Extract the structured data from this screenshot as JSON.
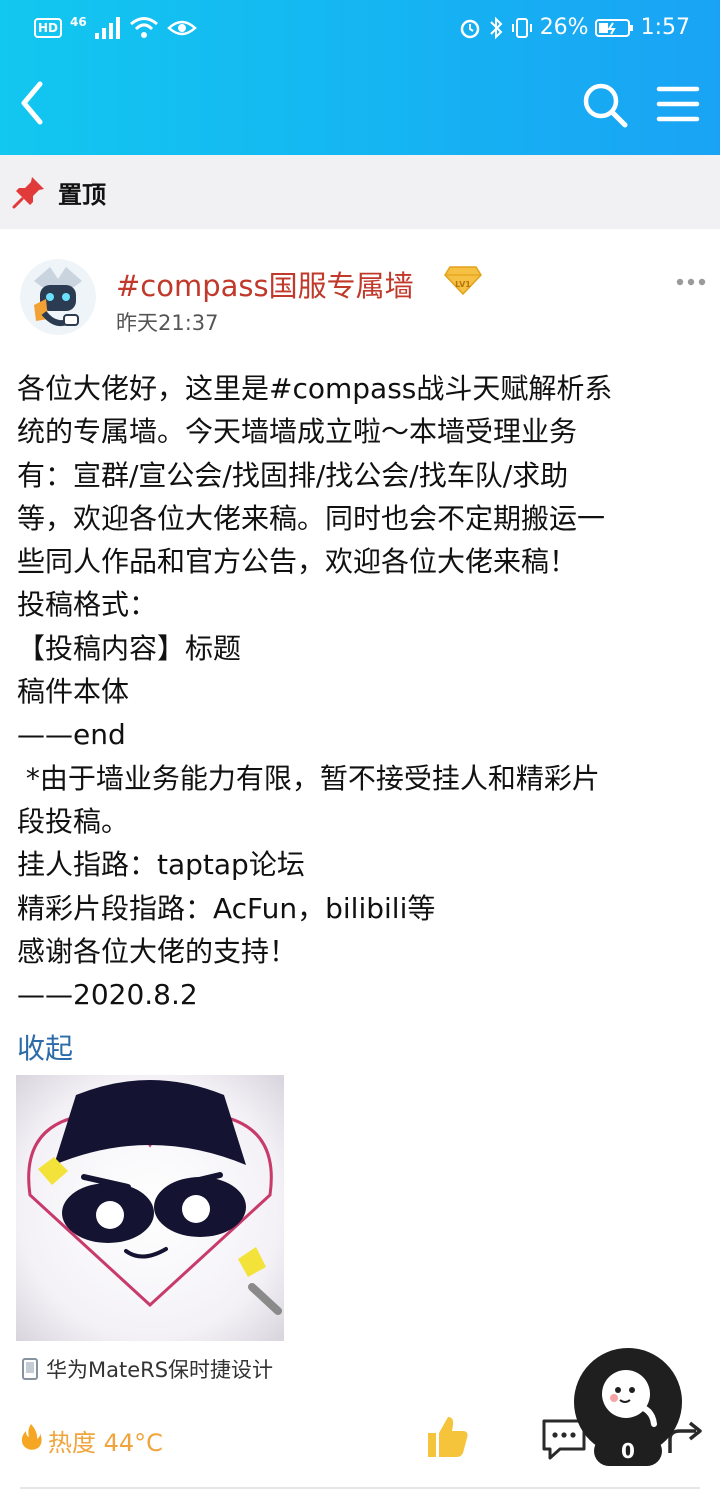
{
  "status_bar": {
    "network": "HD",
    "signal": "46",
    "battery": "26%",
    "time": "1:57"
  },
  "pinned": {
    "label": "置顶"
  },
  "post": {
    "author": "#compass国服专属墙",
    "level": "LV1",
    "time": "昨天21:37",
    "content_lines": [
      "各位大佬好，这里是#compass战斗天赋解析系",
      "统的专属墙。今天墙墙成立啦～本墙受理业务",
      "有：宣群/宣公会/找固排/找公会/找车队/求助",
      "等，欢迎各位大佬来稿。同时也会不定期搬运一",
      "些同人作品和官方公告，欢迎各位大佬来稿！",
      "投稿格式：",
      "【投稿内容】标题",
      "稿件本体",
      "——end",
      " *由于墙业务能力有限，暂不接受挂人和精彩片",
      "段投稿。",
      "挂人指路：taptap论坛",
      "精彩片段指路：AcFun，bilibili等",
      "感谢各位大佬的支持！",
      "——2020.8.2"
    ],
    "collapse_label": "收起",
    "device": "华为MateRS保时捷设计",
    "heat": "热度 44°C"
  },
  "floating_badge": {
    "count": "0"
  },
  "icons": {
    "back": "back-arrow-icon",
    "search": "search-icon",
    "menu": "menu-icon",
    "pin": "pin-icon",
    "more": "more-icon",
    "like": "thumbs-up-icon",
    "comment": "comment-icon",
    "share": "share-icon",
    "heat": "flame-icon"
  },
  "colors": {
    "header_start": "#12c7f0",
    "header_end": "#1aa3f4",
    "author": "#c0392b",
    "link": "#2b6ba8",
    "heat": "#f0a43c"
  }
}
